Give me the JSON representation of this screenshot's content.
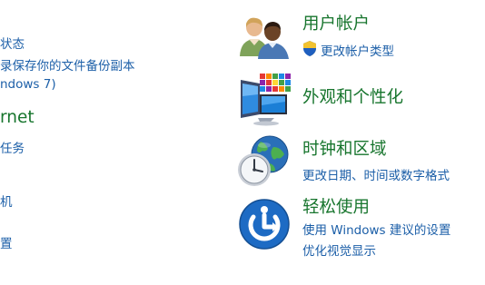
{
  "left_column": {
    "system_security": {
      "link_status_partial": "状态",
      "link_backup_partial": "录保存你的文件备份副本",
      "link_restore_partial": "ndows 7)"
    },
    "network_internet": {
      "title_partial": "rnet",
      "link_tasks_partial": "任务"
    },
    "hardware": {
      "link_machine_partial": "机"
    },
    "programs": {
      "link_settings_partial": "置"
    }
  },
  "right_column": {
    "user_accounts": {
      "title": "用户帐户",
      "link_change_type": "更改帐户类型",
      "icon": "users-icon"
    },
    "appearance": {
      "title": "外观和个性化",
      "icon": "monitor-icon"
    },
    "clock_region": {
      "title": "时钟和区域",
      "link_change_datetime": "更改日期、时间或数字格式",
      "icon": "clock-globe-icon"
    },
    "ease_of_access": {
      "title": "轻松使用",
      "link_suggest_settings": "使用 Windows 建议的设置",
      "link_optimize_display": "优化视觉显示",
      "icon": "ease-of-access-icon"
    }
  },
  "colors": {
    "heading_green": "#17752d",
    "link_blue": "#1c5fa8"
  }
}
